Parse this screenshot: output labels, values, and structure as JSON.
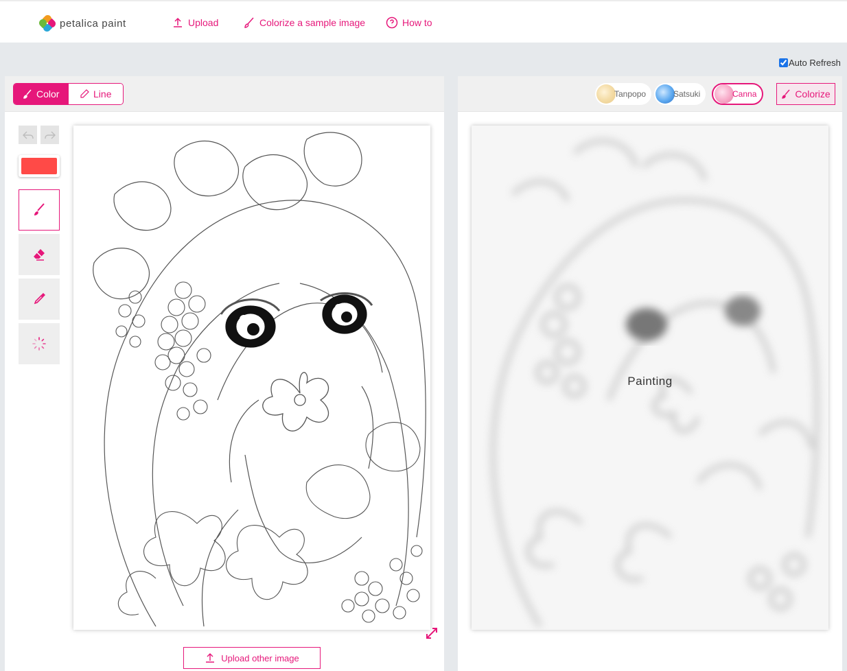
{
  "app": {
    "name": "petalica paint"
  },
  "nav": {
    "upload": "Upload",
    "sample": "Colorize a sample image",
    "howto": "How to"
  },
  "auto_refresh": {
    "label": "Auto Refresh",
    "checked": true
  },
  "left_panel": {
    "mode_color": "Color",
    "mode_line": "Line",
    "current_color": "#ff4a47",
    "tools": [
      "brush-icon",
      "eraser-icon",
      "eyedropper-icon",
      "loading-icon"
    ],
    "upload_other": "Upload other image"
  },
  "right_panel": {
    "styles": [
      {
        "label": "Tanpopo",
        "active": false
      },
      {
        "label": "Satsuki",
        "active": false
      },
      {
        "label": "Canna",
        "active": true
      }
    ],
    "colorize": "Colorize",
    "status": "Painting"
  },
  "colors": {
    "accent": "#e6177a",
    "background": "#e6e9ec"
  }
}
